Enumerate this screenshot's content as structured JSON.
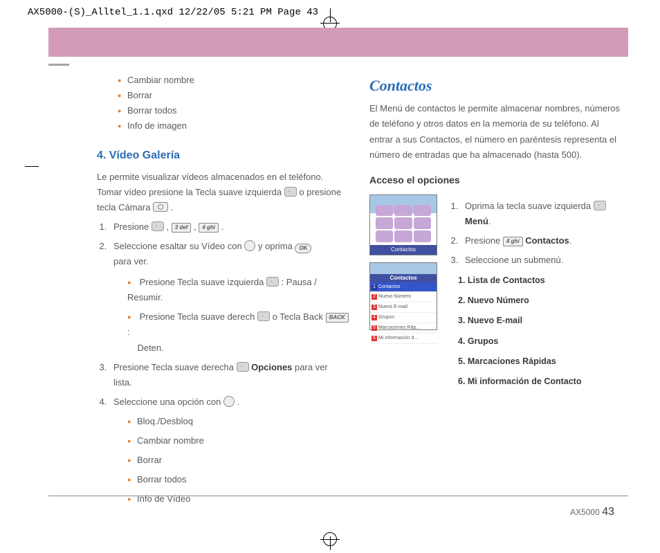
{
  "header": "AX5000-(S)_Alltel_1.1.qxd  12/22/05  5:21 PM  Page 43",
  "left": {
    "bullets1": [
      "Cambiar nombre",
      "Borrar",
      "Borrar todos",
      "Info de imagen"
    ],
    "h3": "4. Vídeo Galería",
    "p1a": "Le permite visualizar vídeos almacenados en el teléfono.",
    "p1b": "Tomar vídeo presione la Tecla suave izquierda ",
    "p1c": " o  presione",
    "p1d": "tecla Cámara ",
    "step1": "Presione ",
    "comma": " , ",
    "period": " .",
    "step2a": "Seleccione esaltar su Vídeo con ",
    "step2b": " y oprima ",
    "step2c": "para ver.",
    "sub2a_a": "Presione Tecla suave izquierda ",
    "sub2a_b": ": Pausa / Resumir.",
    "sub2b_a": "Presione Tecla suave derech ",
    "sub2b_b": " o Tecla Back ",
    "sub2b_c": " :",
    "sub2b_d": "Deten.",
    "step3a": "Presione Tecla suave derecha ",
    "step3b": "Opciones",
    "step3c": " para ver lista.",
    "step4": "Seleccione una opción con ",
    "bullets2": [
      "Bloq./Desbloq",
      "Cambiar nombre",
      "Borrar",
      "Borrar todos",
      "Info de Vídeo"
    ],
    "key3": "3 def",
    "key4": "4 ghi",
    "keyBack": "BACK",
    "keyOK": "OK"
  },
  "right": {
    "title": "Contactos",
    "intro": "El Menú de contactos le permite almacenar nombres, números de teléfono y otros datos en la memoria de su teléfono. Al entrar a sus Contactos, el número en paréntesis representa el número de entradas que ha almacenado (hasta 500).",
    "subhead": "Acceso el opciones",
    "screen1_label": "Contactos",
    "screen2_banner": "Contactos",
    "screen2_rows": [
      "Contactos",
      "Nuevo Número",
      "Nuevo E-mail",
      "Grupos",
      "Marcaciones Ráp...",
      "Mi información d..."
    ],
    "step1a": "Oprima la tecla suave izquierda ",
    "step1b": "Menú",
    "step2a": "Presione ",
    "step2b": "Contactos",
    "step3": "Seleccione un submenú.",
    "submenu": [
      "1.  Lista de Contactos",
      "2.  Nuevo Número",
      "3.  Nuevo E-mail",
      "4.  Grupos",
      "5.  Marcaciones Rápidas",
      "6.  Mi información de Contacto"
    ],
    "key4": "4 ghi"
  },
  "footer": {
    "model": "AX5000",
    "page": "43"
  }
}
